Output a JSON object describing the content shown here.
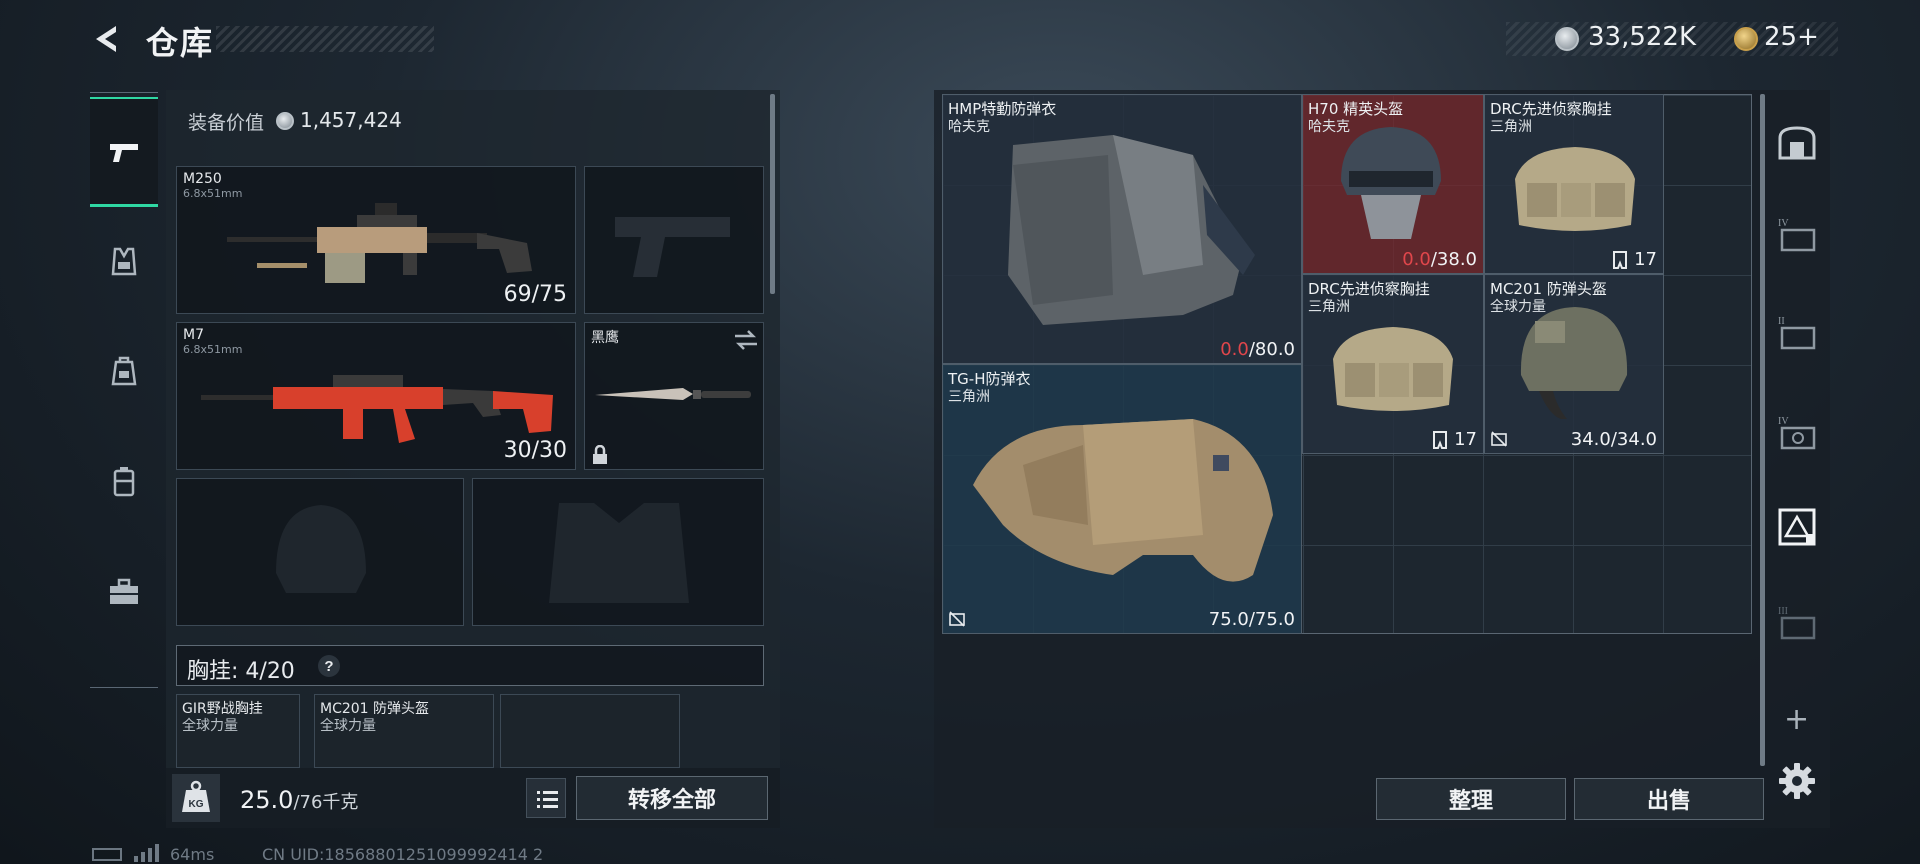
{
  "header": {
    "title": "仓库",
    "silver_amount": "33,522K",
    "gold_amount": "25+"
  },
  "left_nav": {
    "items": [
      "weapons-icon",
      "vest-icon",
      "backpack-icon",
      "case-icon",
      "toolbox-icon"
    ],
    "active": "weapons"
  },
  "loadout": {
    "value_label": "装备价值",
    "value": "1,457,424",
    "primary": {
      "name": "M250",
      "caliber": "6.8x51mm",
      "ammo": "69/75"
    },
    "secondary": {
      "name": "M7",
      "caliber": "6.8x51mm",
      "ammo": "30/30"
    },
    "melee": {
      "name": "黑鹰"
    },
    "chest_rig_label": "胸挂: 4/20",
    "chest_items": [
      {
        "name": "GIR野战胸挂",
        "brand": "全球力量"
      },
      {
        "name": "MC201 防弹头盔",
        "brand": "全球力量"
      }
    ],
    "weight_current": "25.0",
    "weight_max": "/76千克",
    "transfer_all": "转移全部"
  },
  "status_bar": {
    "ping": "64ms",
    "uid": "CN UID:18568801251099992414 2"
  },
  "storage": {
    "items": [
      {
        "name": "HMP特勤防弹衣",
        "brand": "哈夫克",
        "dur_current": "0.0",
        "dur_max": "/80.0"
      },
      {
        "name": "H70 精英头盔",
        "brand": "哈夫克",
        "dur_current": "0.0",
        "dur_max": "/38.0"
      },
      {
        "name": "DRC先进侦察胸挂",
        "brand": "三角洲",
        "count": "17"
      },
      {
        "name": "DRC先进侦察胸挂",
        "brand": "三角洲",
        "count": "17"
      },
      {
        "name": "MC201 防弹头盔",
        "brand": "全球力量",
        "durability": "34.0/34.0"
      },
      {
        "name": "TG-H防弹衣",
        "brand": "三角洲",
        "durability": "75.0/75.0"
      }
    ],
    "sort_label": "整理",
    "sell_label": "出售"
  },
  "right_tabs": [
    "safe-box-icon",
    "container-iv-icon",
    "container-ii-icon",
    "container-iv-b-icon",
    "container-selected-icon",
    "container-iii-icon"
  ],
  "colors": {
    "accent": "#2fd8a3",
    "damage_red": "#e0464b"
  }
}
